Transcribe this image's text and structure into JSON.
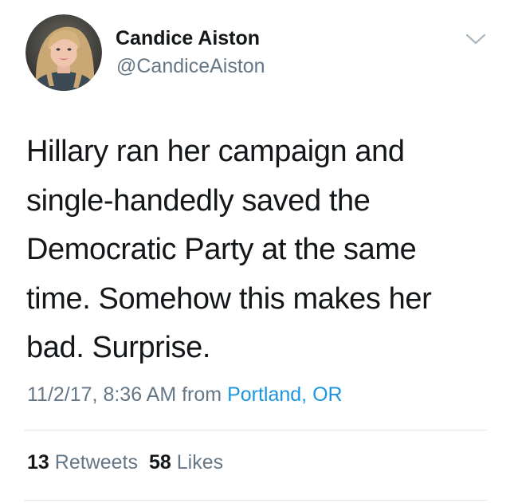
{
  "user": {
    "display_name": "Candice Aiston",
    "handle": "@CandiceAiston",
    "avatar_icon": "profile-photo"
  },
  "menu": {
    "icon": "chevron-down-icon"
  },
  "tweet": {
    "text": "Hillary ran her campaign and\nsingle-handedly saved the\nDemocratic Party at the same\ntime. Somehow this makes her\nbad. Surprise.",
    "timestamp": "11/2/17, 8:36 AM from ",
    "location": "Portland, OR"
  },
  "stats": {
    "retweets_count": "13",
    "retweets_label": " Retweets",
    "likes_count": "58",
    "likes_label": " Likes"
  },
  "colors": {
    "text": "#14171a",
    "secondary": "#657786",
    "link": "#1b95e0",
    "divider": "#e1e8ed"
  }
}
